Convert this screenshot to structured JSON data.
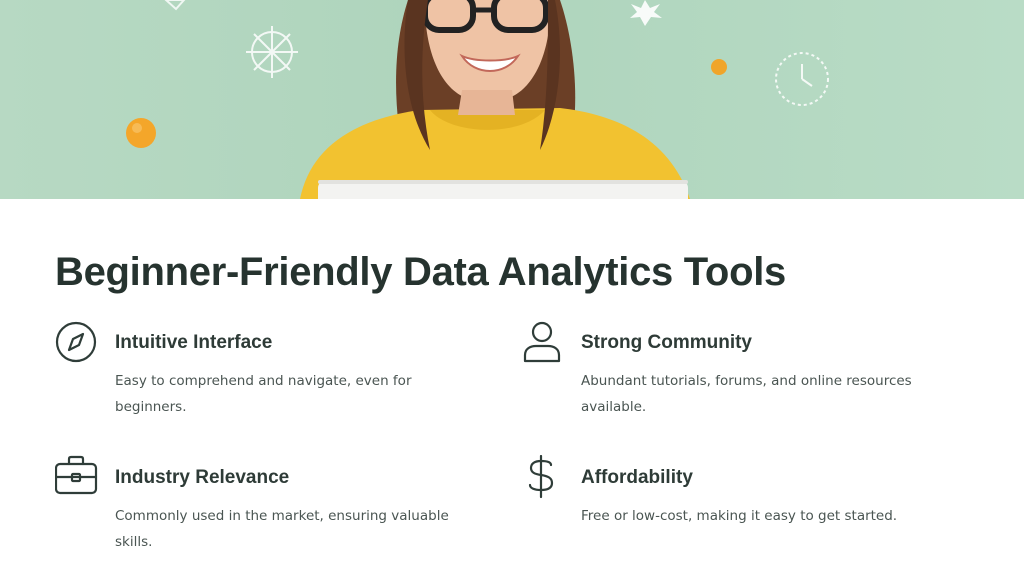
{
  "hero": {
    "image": "woman-with-glasses-smiling-photo"
  },
  "title": "Beginner-Friendly Data Analytics Tools",
  "features": [
    {
      "icon": "compass-icon",
      "title": "Intuitive Interface",
      "description": "Easy to comprehend and navigate, even for beginners."
    },
    {
      "icon": "user-icon",
      "title": "Strong Community",
      "description": "Abundant tutorials, forums, and online resources available."
    },
    {
      "icon": "briefcase-icon",
      "title": "Industry Relevance",
      "description": "Commonly used in the market, ensuring valuable skills."
    },
    {
      "icon": "dollar-icon",
      "title": "Affordability",
      "description": "Free or low-cost, making it easy to get started."
    }
  ],
  "colors": {
    "heading": "#26332f",
    "text": "#4a5552",
    "hero_bg": "#b7d9c3",
    "sweater": "#f2c230"
  }
}
